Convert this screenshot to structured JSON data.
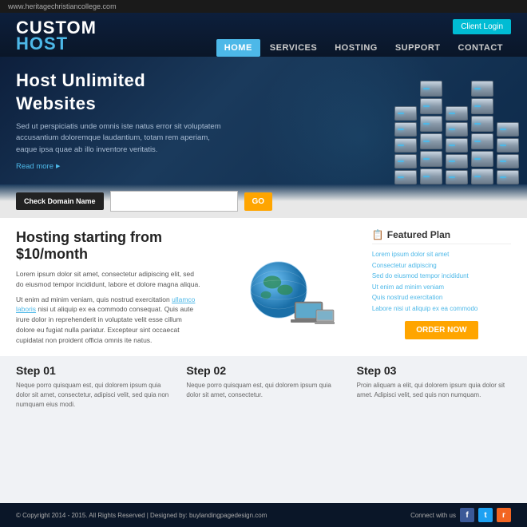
{
  "url_bar": {
    "url": "www.heritagechristiancollege.com"
  },
  "header": {
    "logo": {
      "line1": "CUSTOM",
      "line2": "HOST"
    },
    "client_login": "Client Login",
    "nav": [
      {
        "label": "HOME",
        "active": true
      },
      {
        "label": "SERVICES",
        "active": false
      },
      {
        "label": "HOSTING",
        "active": false
      },
      {
        "label": "SUPPORT",
        "active": false
      },
      {
        "label": "CONTACT",
        "active": false
      }
    ]
  },
  "hero": {
    "title": "Host Unlimited Websites",
    "description": "Sed ut perspiciatis unde omnis iste natus error sit voluptatem accusantium doloremque laudantium, totam rem aperiam, eaque ipsa quae ab illo inventore veritatis.",
    "read_more": "Read more"
  },
  "domain_search": {
    "check_btn": "Check Domain Name",
    "placeholder": "",
    "go_btn": "GO"
  },
  "hosting": {
    "title": "Hosting starting from $10/month",
    "para1": "Lorem ipsum dolor sit amet, consectetur adipiscing elit, sed do eiusmod tempor incididunt, labore et dolore magna aliqua.",
    "para2": "Ut enim ad minim veniam, quis nostrud exercitation ullamco laboris nisi ut aliquip ex ea commodo consequat. Quis aute irure dolor in reprehenderit in voluptate velit esse cillum dolore eu fugiat nulla pariatur. Excepteur sint occaecat cupidatat non proident officia omnis ite natus.",
    "link_text": "ullamco laboris"
  },
  "featured_plan": {
    "title": "Featured Plan",
    "icon": "📋",
    "items": [
      "Lorem ipsum dolor sit amet",
      "Consectetur adipiscing",
      "Sed do eiusmod tempor incididunt",
      "Ut enim ad minim veniam",
      "Quis nostrud exercitation",
      "Labore nisi ut aliquip ex ea commodo"
    ],
    "order_btn": "ORDER NOW"
  },
  "steps": [
    {
      "title": "Step 01",
      "desc": "Neque porro quisquam est, qui dolorem ipsum quia dolor sit amet, consectetur, adipisci velit, sed quia non numquam eius modi."
    },
    {
      "title": "Step 02",
      "desc": "Neque porro quisquam est, qui dolorem ipsum quia dolor sit amet, consectetur."
    },
    {
      "title": "Step 03",
      "desc": "Proin aliquam a elit, qui dolorem ipsum quia dolor sit amet. Adipisci velit, sed quis non numquam."
    }
  ],
  "footer": {
    "copyright": "© Copyright 2014 - 2015. All Rights Reserved | Designed by: buylandingpagedesign.com",
    "connect_label": "Connect with us",
    "social": [
      "f",
      "t",
      "r"
    ]
  }
}
